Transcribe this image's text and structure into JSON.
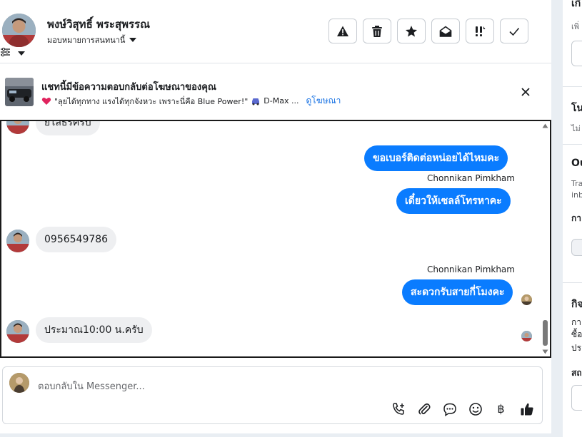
{
  "header": {
    "contact_name": "พงษ์วิสุทธิ์ พระสุพรรณ",
    "assign_label": "มอบหมายการสนทนานี้",
    "actions": [
      "report-icon",
      "trash-icon",
      "star-icon",
      "mark-unread-icon",
      "important-icon",
      "done-icon"
    ]
  },
  "ad_banner": {
    "title": "แชทนี้มีข้อความตอบกลับต่อโฆษณาของคุณ",
    "snippet": "\"ลุยได้ทุกทาง แรงได้ทุกจังหวะ เพราะนี่คือ Blue Power!\"",
    "snippet_tail": "D-Max ...",
    "link": "ดูโฆษณา"
  },
  "messages": {
    "partial_top": "ย้ไลธ์รครับ",
    "out1": "ขอเบอร์ติดต่อหน่อยได้ไหมคะ",
    "sender1": "Chonnikan Pimkham",
    "out2": "เดี๋ยวให้เซลล์โทรหาคะ",
    "in1": "0956549786",
    "sender2": "Chonnikan Pimkham",
    "out3": "สะดวกรับสายกี่โมงคะ",
    "in2": "ประมาณ10:00 น.ครับ"
  },
  "composer": {
    "placeholder": "ตอบกลับใน Messenger...",
    "tools": [
      "add-call-icon",
      "attach-icon",
      "saved-reply-icon",
      "emoji-icon",
      "baht-icon",
      "like-icon"
    ],
    "baht_symbol": "฿"
  },
  "right_panel": {
    "frag1": "เกี",
    "frag2": "เพิ่",
    "frag3": "โน",
    "frag4": "ไม่",
    "frag5": "Ou",
    "frag6": "Tra",
    "frag7": "inb",
    "frag8": "กา",
    "frag9": "กิจ",
    "frag10": "กา",
    "frag11": "ซื้อ",
    "frag12": "ปร",
    "frag13": "สถ"
  },
  "colors": {
    "accent": "#0a7cff",
    "link": "#1b74e4",
    "incoming_bubble": "#eeeff1"
  }
}
